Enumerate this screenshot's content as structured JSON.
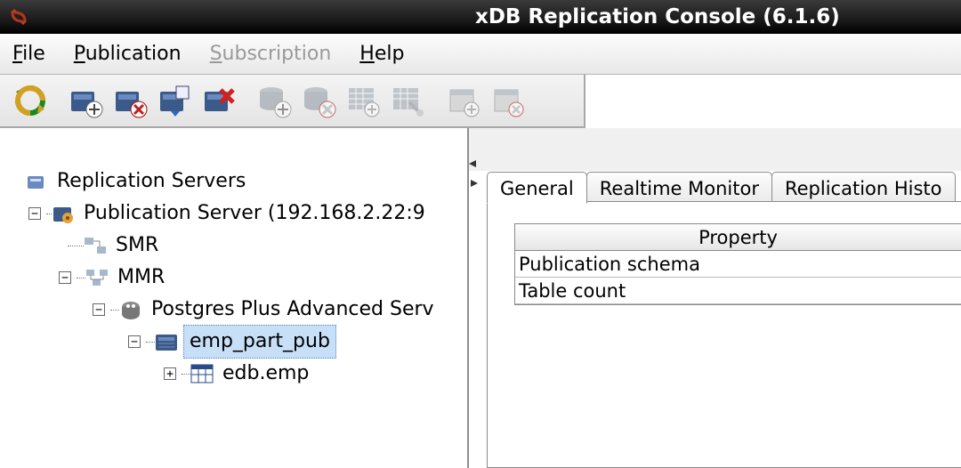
{
  "title": "xDB Replication Console (6.1.6)",
  "menu": {
    "file": "File",
    "publication": "Publication",
    "subscription": "Subscription",
    "help": "Help"
  },
  "tree": {
    "root": "Replication Servers",
    "pub_server": "Publication Server (192.168.2.22:9",
    "smr": "SMR",
    "mmr": "MMR",
    "db": "Postgres Plus Advanced Serv",
    "pub": "emp_part_pub",
    "table": "edb.emp"
  },
  "tabs": {
    "general": "General",
    "realtime": "Realtime Monitor",
    "history": "Replication Histo"
  },
  "properties": {
    "header": "Property",
    "rows": [
      "Publication schema",
      "Table count"
    ]
  }
}
